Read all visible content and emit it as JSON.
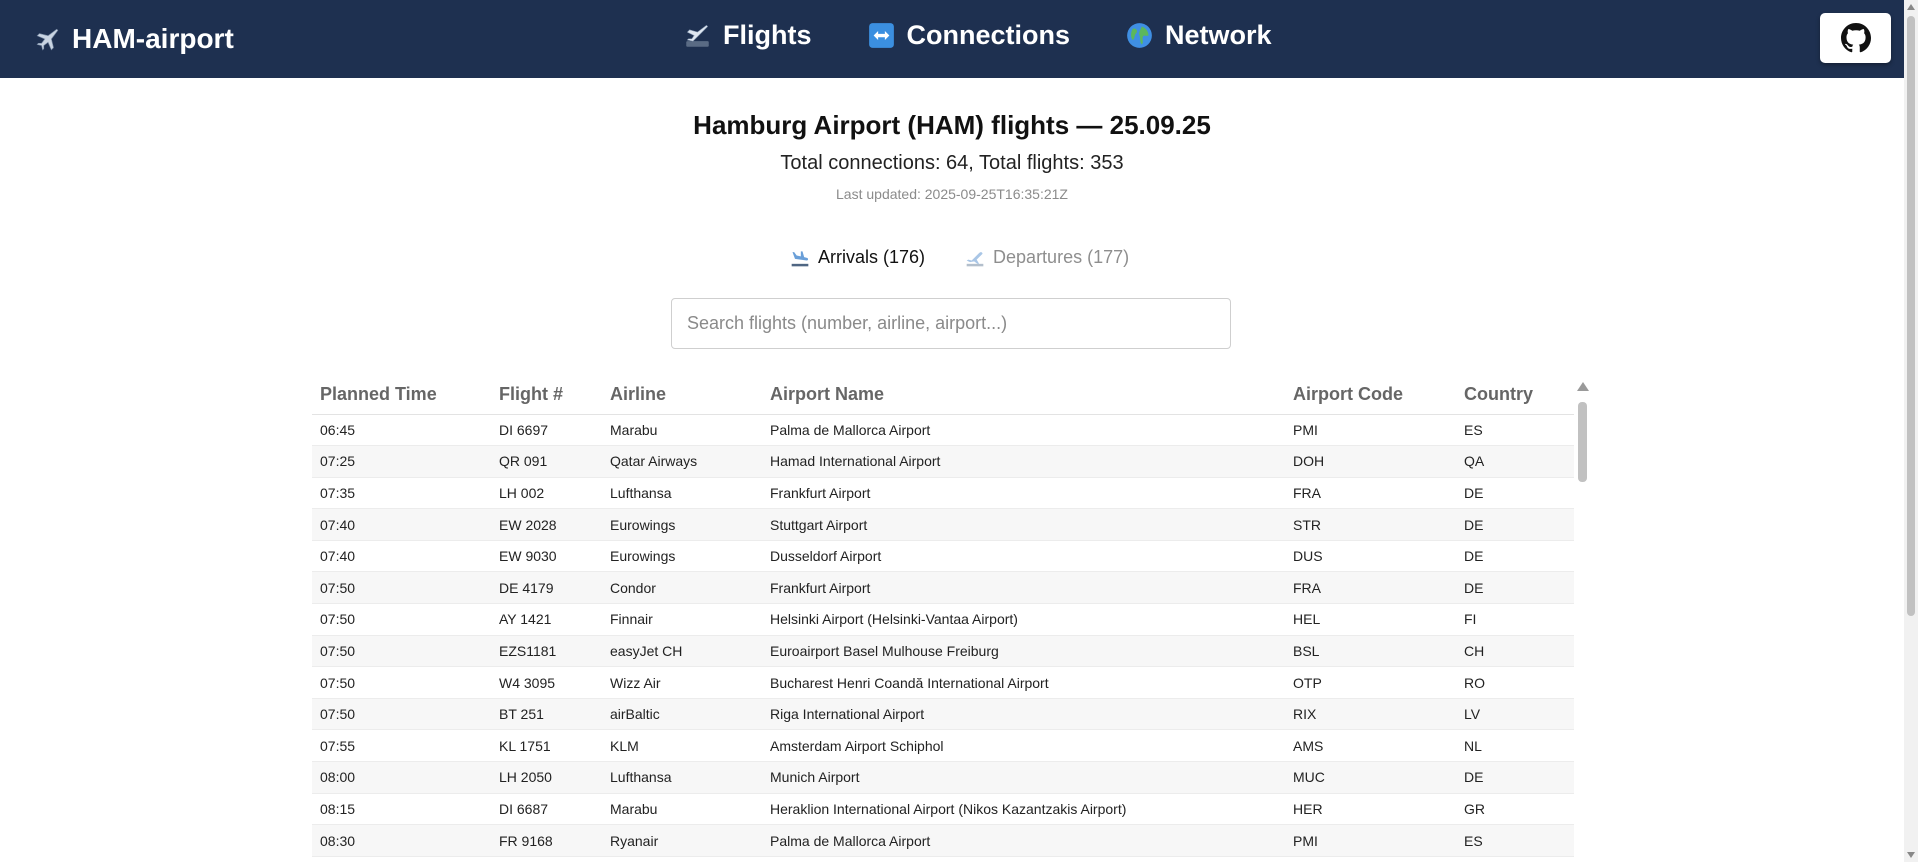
{
  "nav": {
    "brand": "HAM-airport",
    "brand_icon": "airplane-icon",
    "links": [
      {
        "label": "Flights",
        "icon": "departure-board-icon"
      },
      {
        "label": "Connections",
        "icon": "left-right-arrow-icon"
      },
      {
        "label": "Network",
        "icon": "globe-icon"
      }
    ],
    "github_icon": "github-icon"
  },
  "header": {
    "title": "Hamburg Airport (HAM) flights — 25.09.25",
    "totals": "Total connections: 64, Total flights: 353",
    "last_updated": "Last updated: 2025-09-25T16:35:21Z"
  },
  "tabs": [
    {
      "label": "Arrivals (176)",
      "icon": "airplane-arrival-icon",
      "active": true
    },
    {
      "label": "Departures (177)",
      "icon": "airplane-departure-icon",
      "active": false
    }
  ],
  "search": {
    "placeholder": "Search flights (number, airline, airport...)",
    "value": ""
  },
  "table": {
    "headers": [
      "Planned Time",
      "Flight #",
      "Airline",
      "Airport Name",
      "Airport Code",
      "Country"
    ],
    "rows": [
      [
        "06:45",
        "DI 6697",
        "Marabu",
        "Palma de Mallorca Airport",
        "PMI",
        "ES"
      ],
      [
        "07:25",
        "QR 091",
        "Qatar Airways",
        "Hamad International Airport",
        "DOH",
        "QA"
      ],
      [
        "07:35",
        "LH 002",
        "Lufthansa",
        "Frankfurt Airport",
        "FRA",
        "DE"
      ],
      [
        "07:40",
        "EW 2028",
        "Eurowings",
        "Stuttgart Airport",
        "STR",
        "DE"
      ],
      [
        "07:40",
        "EW 9030",
        "Eurowings",
        "Dusseldorf Airport",
        "DUS",
        "DE"
      ],
      [
        "07:50",
        "DE 4179",
        "Condor",
        "Frankfurt Airport",
        "FRA",
        "DE"
      ],
      [
        "07:50",
        "AY 1421",
        "Finnair",
        "Helsinki Airport (Helsinki-Vantaa Airport)",
        "HEL",
        "FI"
      ],
      [
        "07:50",
        "EZS1181",
        "easyJet CH",
        "Euroairport Basel Mulhouse Freiburg",
        "BSL",
        "CH"
      ],
      [
        "07:50",
        "W4 3095",
        "Wizz Air",
        "Bucharest Henri Coandă International Airport",
        "OTP",
        "RO"
      ],
      [
        "07:50",
        "BT 251",
        "airBaltic",
        "Riga International Airport",
        "RIX",
        "LV"
      ],
      [
        "07:55",
        "KL 1751",
        "KLM",
        "Amsterdam Airport Schiphol",
        "AMS",
        "NL"
      ],
      [
        "08:00",
        "LH 2050",
        "Lufthansa",
        "Munich Airport",
        "MUC",
        "DE"
      ],
      [
        "08:15",
        "DI 6687",
        "Marabu",
        "Heraklion International Airport (Nikos Kazantzakis Airport)",
        "HER",
        "GR"
      ],
      [
        "08:30",
        "FR 9168",
        "Ryanair",
        "Palma de Mallorca Airport",
        "PMI",
        "ES"
      ]
    ]
  },
  "colors": {
    "nav_bg": "#1e3050",
    "muted_text": "#8b8b8b",
    "stripe": "#f7f7f7"
  }
}
